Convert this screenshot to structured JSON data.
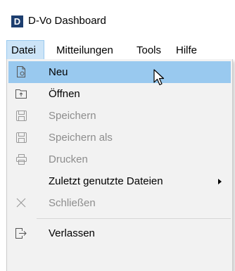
{
  "window": {
    "logo_letter": "D",
    "title": "D-Vo Dashboard"
  },
  "menubar": {
    "items": [
      {
        "label": "Datei"
      },
      {
        "label": "Mitteilungen"
      },
      {
        "label": "Tools"
      },
      {
        "label": "Hilfe"
      }
    ]
  },
  "file_menu": {
    "items": [
      {
        "label": "Neu",
        "icon": "new-document-icon",
        "state": "highlighted"
      },
      {
        "label": "Öffnen",
        "icon": "open-folder-icon",
        "state": "enabled"
      },
      {
        "label": "Speichern",
        "icon": "save-icon",
        "state": "disabled"
      },
      {
        "label": "Speichern als",
        "icon": "save-as-icon",
        "state": "disabled"
      },
      {
        "label": "Drucken",
        "icon": "printer-icon",
        "state": "disabled"
      },
      {
        "label": "Zuletzt genutzte Dateien",
        "icon": "",
        "state": "enabled",
        "submenu": true
      },
      {
        "label": "Schließen",
        "icon": "close-icon",
        "state": "disabled"
      },
      {
        "label": "Verlassen",
        "icon": "exit-icon",
        "state": "enabled"
      }
    ]
  },
  "colors": {
    "highlight": "#99c9ef",
    "menubar_active": "#cce4f7",
    "logo_bg": "#1d3e6f",
    "disabled_text": "#8d8d8d"
  }
}
